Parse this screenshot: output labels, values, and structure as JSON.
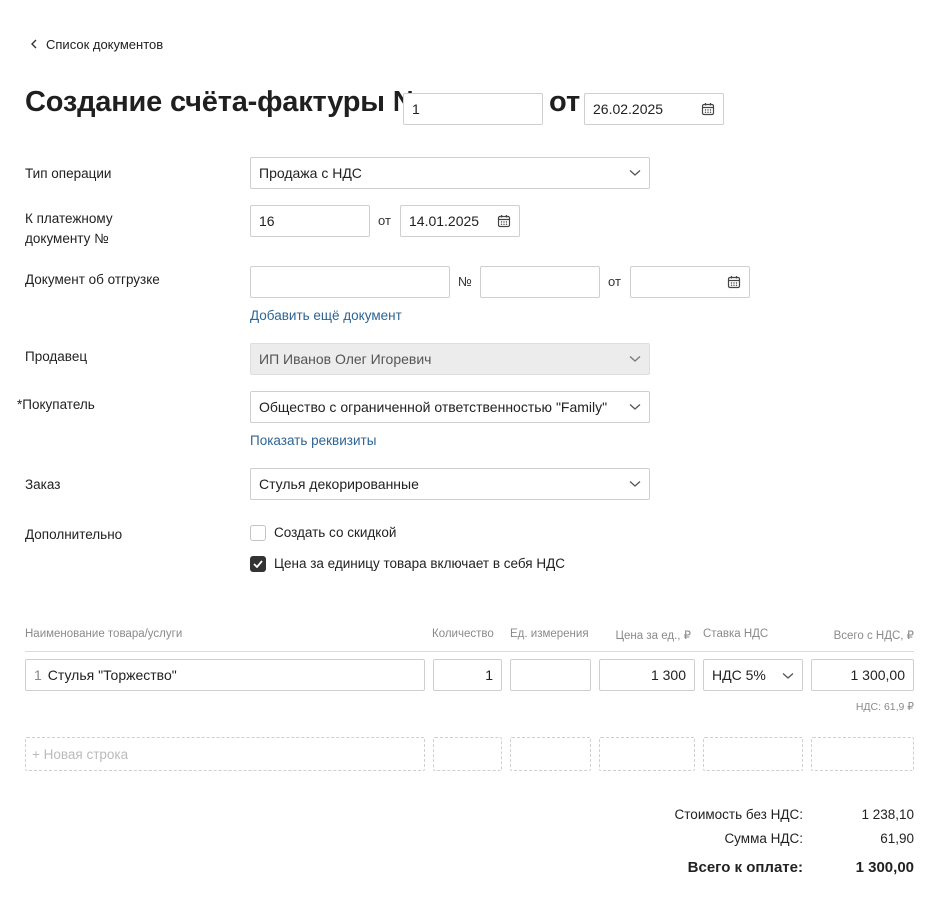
{
  "back_link": "Список документов",
  "header": {
    "title": "Создание счёта-фактуры №",
    "number": "1",
    "ot": "от",
    "date": "26.02.2025"
  },
  "form": {
    "operation_type_label": "Тип операции",
    "operation_type_value": "Продажа с НДС",
    "payment_doc_label_1": "К платежному",
    "payment_doc_label_2": "документу №",
    "payment_doc_number": "16",
    "payment_doc_ot": "от",
    "payment_doc_date": "14.01.2025",
    "shipment_doc_label": "Документ об отгрузке",
    "shipment_doc_type": "",
    "shipment_no_label": "№",
    "shipment_doc_number": "",
    "shipment_ot": "от",
    "shipment_doc_date": "",
    "add_doc_link": "Добавить ещё документ",
    "seller_label": "Продавец",
    "seller_value": "ИП Иванов Олег Игоревич",
    "buyer_required_mark": "*",
    "buyer_label": "Покупатель",
    "buyer_value": "Общество с ограниченной ответственностью \"Family\"",
    "show_details_link": "Показать реквизиты",
    "order_label": "Заказ",
    "order_value": "Стулья декорированные",
    "extra_label": "Дополнительно",
    "discount_checkbox_label": "Создать со скидкой",
    "discount_checked": false,
    "vat_included_label": "Цена за единицу товара включает в себя НДС",
    "vat_included_checked": true
  },
  "table": {
    "headers": {
      "name": "Наименование товара/услуги",
      "qty": "Количество",
      "unit": "Ед. измерения",
      "price": "Цена за ед., ₽",
      "vat_rate": "Ставка НДС",
      "total": "Всего с НДС, ₽"
    },
    "rows": [
      {
        "index": "1",
        "name": "Стулья \"Торжество\"",
        "qty": "1",
        "unit": "",
        "price": "1 300",
        "vat_rate": "НДС 5%",
        "total": "1 300,00",
        "vat_note": "НДС: 61,9 ₽"
      }
    ],
    "new_row_placeholder": "+ Новая строка"
  },
  "summary": {
    "without_vat_label": "Стоимость без НДС:",
    "without_vat_value": "1 238,10",
    "vat_sum_label": "Сумма НДС:",
    "vat_sum_value": "61,90",
    "total_label": "Всего к оплате:",
    "total_value": "1 300,00"
  },
  "colors": {
    "link": "#2d6593",
    "checkbox_checked": "#333333",
    "disabled_bg": "#ececec"
  }
}
